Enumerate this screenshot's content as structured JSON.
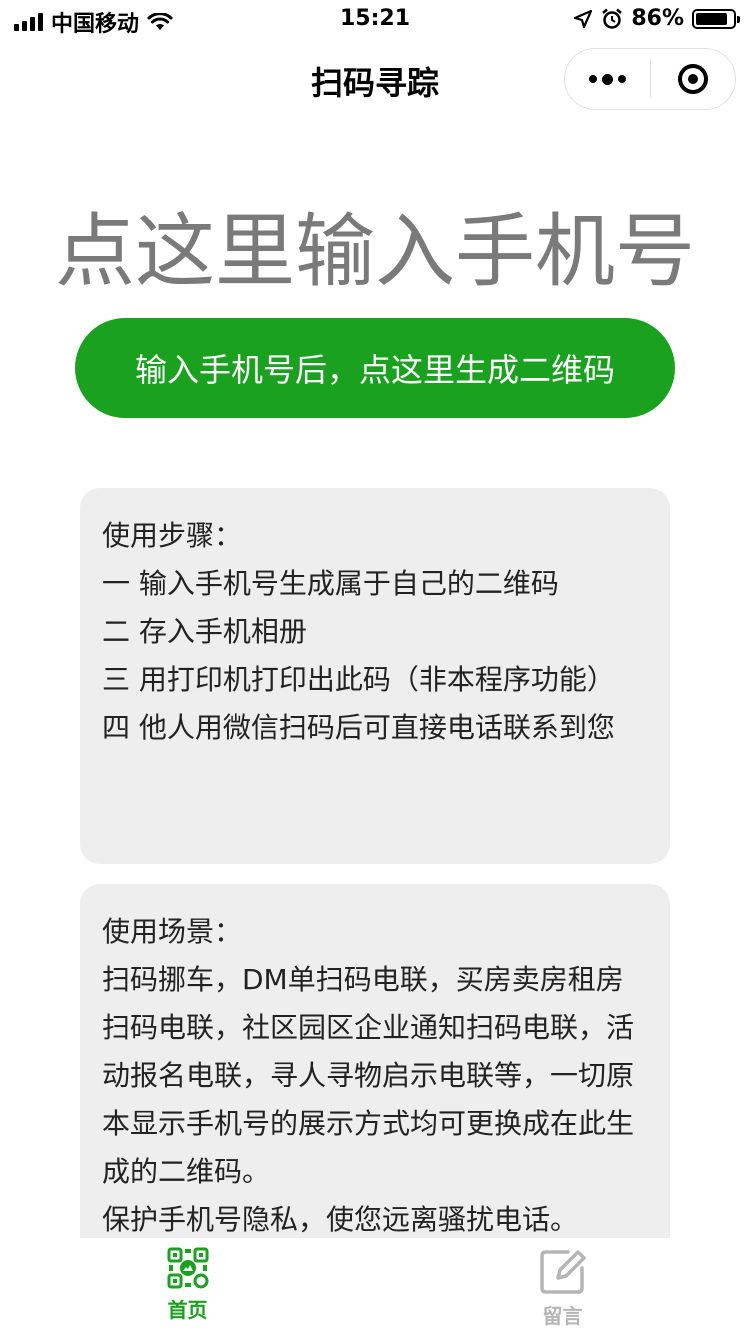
{
  "status_bar": {
    "carrier": "中国移动",
    "time": "15:21",
    "battery": "86%",
    "battery_level": 0.86
  },
  "nav": {
    "title": "扫码寻踪"
  },
  "phone_input": {
    "placeholder": "点这里输入手机号",
    "value": ""
  },
  "generate_button": {
    "label": "输入手机号后，点这里生成二维码"
  },
  "steps_card": {
    "title": "使用步骤：",
    "lines": [
      "一 输入手机号生成属于自己的二维码",
      "二 存入手机相册",
      "三 用打印机打印出此码（非本程序功能）",
      "四 他人用微信扫码后可直接电话联系到您"
    ]
  },
  "scenes_card": {
    "title": "使用场景：",
    "paragraphs": [
      "扫码挪车，DM单扫码电联，买房卖房租房扫码电联，社区园区企业通知扫码电联，活动报名电联，寻人寻物启示电联等，一切原本显示手机号的展示方式均可更换成在此生成的二维码。",
      "保护手机号隐私，使您远离骚扰电话。"
    ]
  },
  "tabbar": {
    "items": [
      {
        "label": "首页",
        "icon": "qr-code-icon",
        "active": true
      },
      {
        "label": "留言",
        "icon": "edit-icon",
        "active": false
      }
    ]
  },
  "colors": {
    "primary_green": "#1aa11f",
    "card_bg": "#eeeeee",
    "tab_inactive": "#b5b5b5"
  }
}
